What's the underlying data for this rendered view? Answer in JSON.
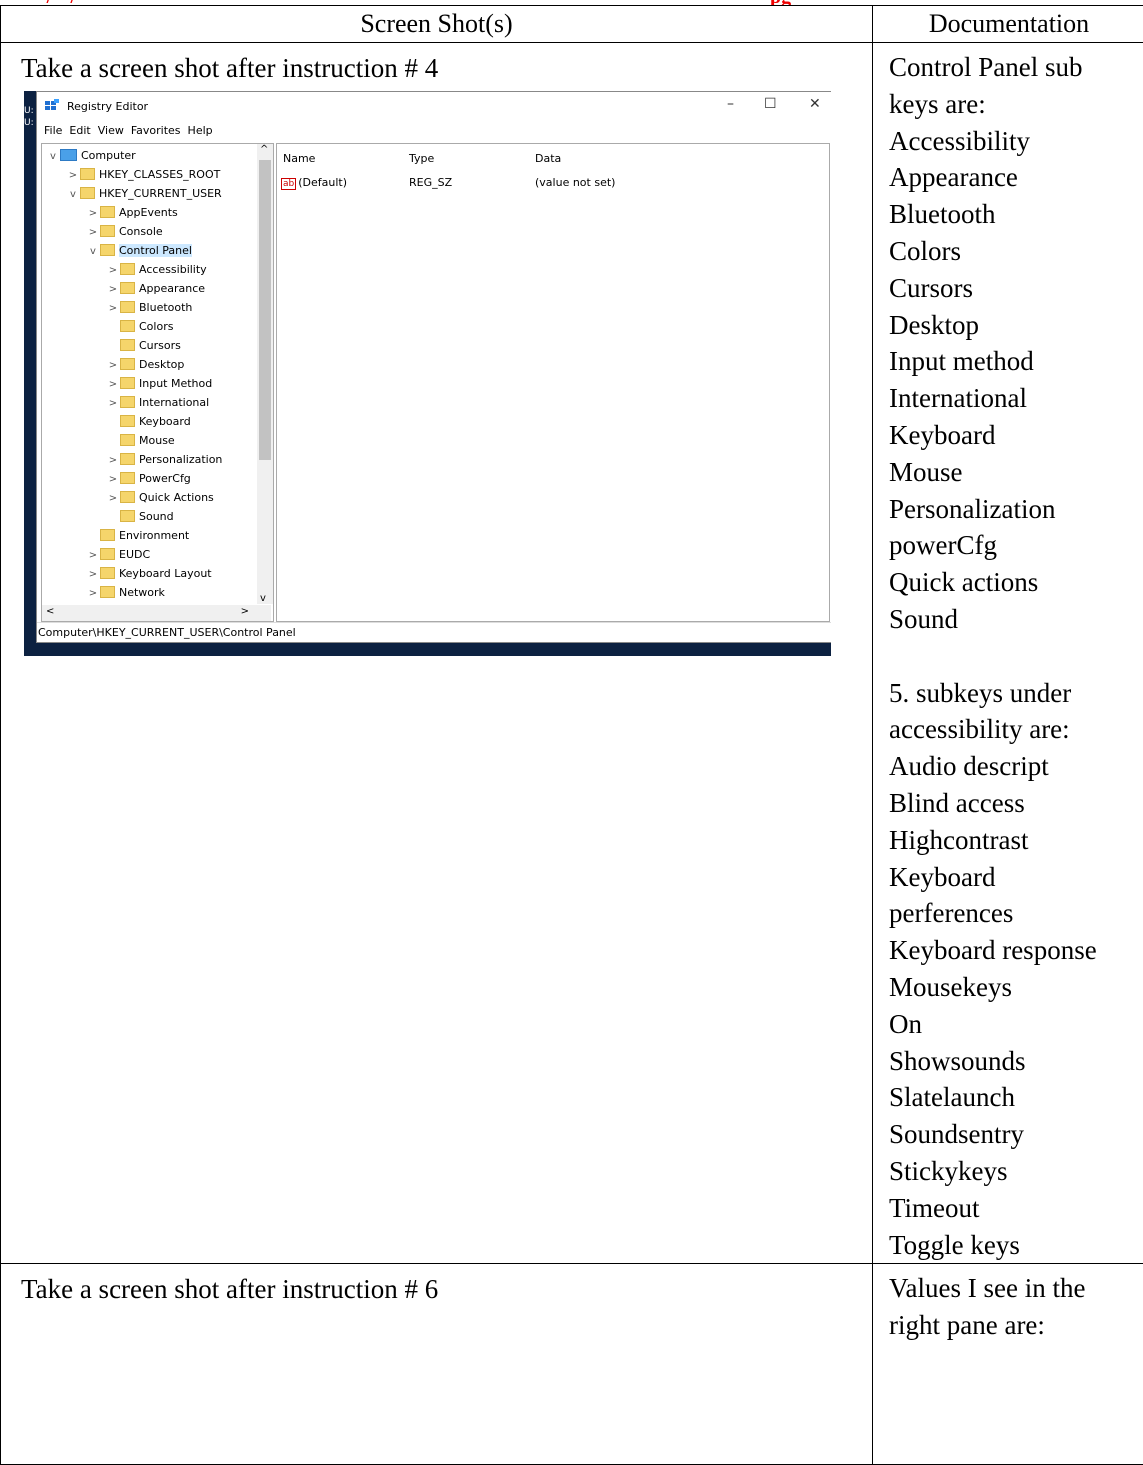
{
  "header": {
    "left": "Screen Shot(s)",
    "right": "Documentation"
  },
  "row1": {
    "caption": "Take a screen shot after instruction # 4",
    "documentation": [
      "Control Panel sub",
      "keys are:",
      "Accessibility",
      "Appearance",
      "Bluetooth",
      "Colors",
      "Cursors",
      "Desktop",
      "Input method",
      "International",
      "Keyboard",
      "Mouse",
      "Personalization",
      "powerCfg",
      "Quick actions",
      "Sound",
      "",
      "5. subkeys under",
      "accessibility are:",
      "Audio descript",
      "Blind access",
      "Highcontrast",
      "Keyboard",
      "perferences",
      "Keyboard response",
      "Mousekeys",
      "On",
      "Showsounds",
      "Slatelaunch",
      "Soundsentry",
      "Stickykeys",
      "Timeout",
      "Toggle keys"
    ]
  },
  "row2": {
    "caption": "Take a screen shot after instruction # 6",
    "documentation": [
      "Values I see in the",
      "right pane are:"
    ]
  },
  "registry": {
    "title": "Registry Editor",
    "edge_text": [
      "U:",
      "U:"
    ],
    "window_buttons": {
      "minimize": "–",
      "maximize": "☐",
      "close": "✕"
    },
    "menu": [
      "File",
      "Edit",
      "View",
      "Favorites",
      "Help"
    ],
    "tree": [
      {
        "label": "Computer",
        "chev": "v",
        "icon": "computer-icon"
      },
      {
        "label": "HKEY_CLASSES_ROOT",
        "chev": ">"
      },
      {
        "label": "HKEY_CURRENT_USER",
        "chev": "v"
      },
      {
        "label": "AppEvents",
        "chev": ">"
      },
      {
        "label": "Console",
        "chev": ">"
      },
      {
        "label": "Control Panel",
        "chev": "v",
        "selected": true
      },
      {
        "label": "Accessibility",
        "chev": ">"
      },
      {
        "label": "Appearance",
        "chev": ">"
      },
      {
        "label": "Bluetooth",
        "chev": ">"
      },
      {
        "label": "Colors",
        "chev": ""
      },
      {
        "label": "Cursors",
        "chev": ""
      },
      {
        "label": "Desktop",
        "chev": ">"
      },
      {
        "label": "Input Method",
        "chev": ">"
      },
      {
        "label": "International",
        "chev": ">"
      },
      {
        "label": "Keyboard",
        "chev": ""
      },
      {
        "label": "Mouse",
        "chev": ""
      },
      {
        "label": "Personalization",
        "chev": ">"
      },
      {
        "label": "PowerCfg",
        "chev": ">"
      },
      {
        "label": "Quick Actions",
        "chev": ">"
      },
      {
        "label": "Sound",
        "chev": ""
      },
      {
        "label": "Environment",
        "chev": ""
      },
      {
        "label": "EUDC",
        "chev": ">"
      },
      {
        "label": "Keyboard Layout",
        "chev": ">"
      },
      {
        "label": "Network",
        "chev": ">"
      }
    ],
    "columns": {
      "name": "Name",
      "type": "Type",
      "data": "Data"
    },
    "values": [
      {
        "name": "(Default)",
        "type": "REG_SZ",
        "data": "(value not set)",
        "icon_text": "ab"
      }
    ],
    "scroll_glyphs": {
      "up": "^",
      "down": "v",
      "left": "<",
      "right": ">"
    },
    "status": "Computer\\HKEY_CURRENT_USER\\Control Panel"
  },
  "colors": {
    "taskbar": "#0c2141",
    "folder": "#f5d56b",
    "selection": "#cce8ff",
    "header_strip": "#e00000"
  }
}
